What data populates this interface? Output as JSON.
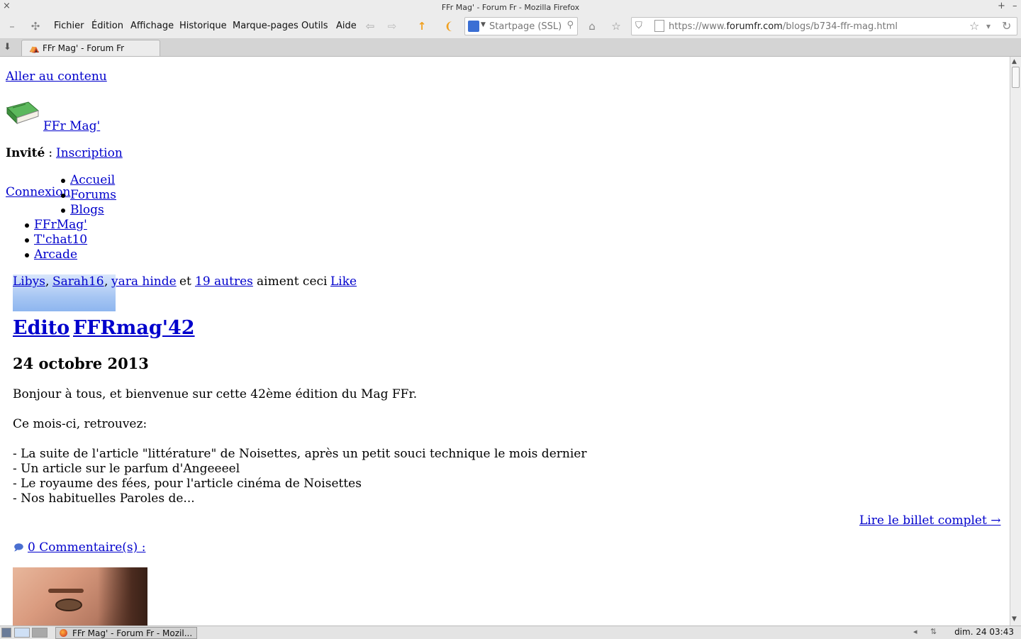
{
  "window": {
    "title": "FFr Mag' - Forum Fr - Mozilla Firefox",
    "btn_left": "×",
    "btn_right_plus": "+",
    "btn_right_minus": "–"
  },
  "menu": {
    "items": [
      "Fichier",
      "Édition",
      "Affichage",
      "Historique",
      "Marque-pages",
      "Outils",
      "Aide"
    ]
  },
  "toolbar": {
    "back_icon": "arrow-left-icon",
    "forward_icon": "arrow-right-icon",
    "search_placeholder": "Startpage (SSL)",
    "url_prefix": "https://www.",
    "url_domain": "forumfr.com",
    "url_path": "/blogs/b734-ffr-mag.html"
  },
  "tabs": {
    "active_label": "FFr Mag' - Forum Fr"
  },
  "page": {
    "skip_link": "Aller au contenu",
    "site_name": "FFr Mag'",
    "guest_label": "Invité",
    "guest_sep": " : ",
    "register_link": "Inscription",
    "login_link": "Connexion",
    "nav_inner": [
      "Accueil",
      "Forums",
      "Blogs"
    ],
    "nav_outer": [
      "FFrMag'",
      "T'chat10",
      "Arcade"
    ],
    "likes": {
      "user1": "Libys",
      "user2": "Sarah16",
      "user3": "yara hinde",
      "and": "et",
      "others": "19 autres",
      "like_text": "aiment ceci",
      "like_button": "Like",
      "sep": ","
    },
    "post": {
      "title_part1": "Edito",
      "title_part2": "FFRmag'42",
      "date": "24 octobre 2013",
      "intro": "Bonjour à tous, et bienvenue sur cette 42ème édition du Mag FFr.",
      "subhead": "Ce mois-ci, retrouvez:",
      "lines": [
        "- La suite de l'article \"littérature\" de Noisettes, après un petit souci technique le mois dernier",
        "- Un article sur le parfum d'Angeeeel",
        "- Le royaume des fées, pour l'article cinéma de Noisettes",
        "- Nos habituelles Paroles de..."
      ],
      "read_more": "Lire le billet complet →",
      "comments": "0 Commentaire(s) :"
    }
  },
  "taskbar": {
    "task_label": "FFr Mag' - Forum Fr - Mozil...",
    "clock": "dim. 24   03:43"
  }
}
